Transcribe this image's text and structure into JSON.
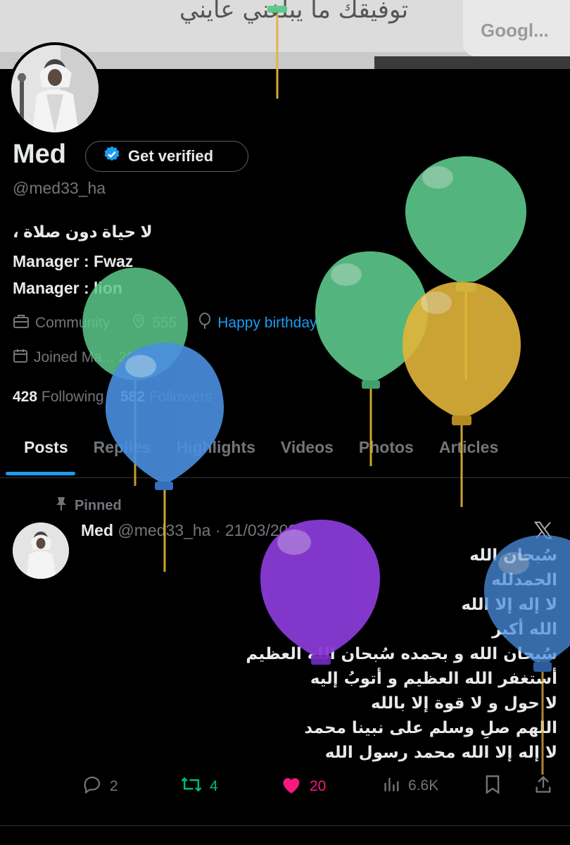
{
  "banner": {
    "arabic_text": "توفيقك ما يبلغني عايني",
    "search_text": "Googl..."
  },
  "profile": {
    "name": "Med",
    "verify_label": "Get verified",
    "handle": "@med33_ha",
    "bio": [
      "لا حياة دون صلاة ،",
      "Manager : Fwaz",
      "Manager : lion"
    ],
    "category": "Community",
    "location": "555",
    "birthday_text": "Happy birthday!",
    "joined": "Joined Ma... 2021",
    "following_count": "428",
    "following_label": "Following",
    "followers_count": "582",
    "followers_label": "Followers"
  },
  "tabs": [
    "Posts",
    "Replies",
    "Highlights",
    "Videos",
    "Photos",
    "Articles"
  ],
  "active_tab": "Posts",
  "tweet": {
    "pinned_label": "Pinned",
    "author": "Med",
    "handle_date": "@med33_ha · 21/03/2025",
    "lines": [
      "سُبحان الله",
      "الحمدلله",
      "لا إله إلا الله",
      "الله أكبر",
      "سُبحان الله و بحمده سُبحان الله العظيم",
      "أستغفر الله العظيم و أتوبُ إليه",
      "لا حول و لا قوة إلا بالله",
      "اللهم صلِ وسلم على نبينا محمد",
      "لا إله إلا الله محمد رسول الله"
    ],
    "replies": "2",
    "reposts": "4",
    "likes": "20",
    "views": "6.6K"
  },
  "colors": {
    "accent": "#1d9bf0",
    "like": "#f91880",
    "repost": "#00ba7c",
    "muted": "#71767b"
  }
}
